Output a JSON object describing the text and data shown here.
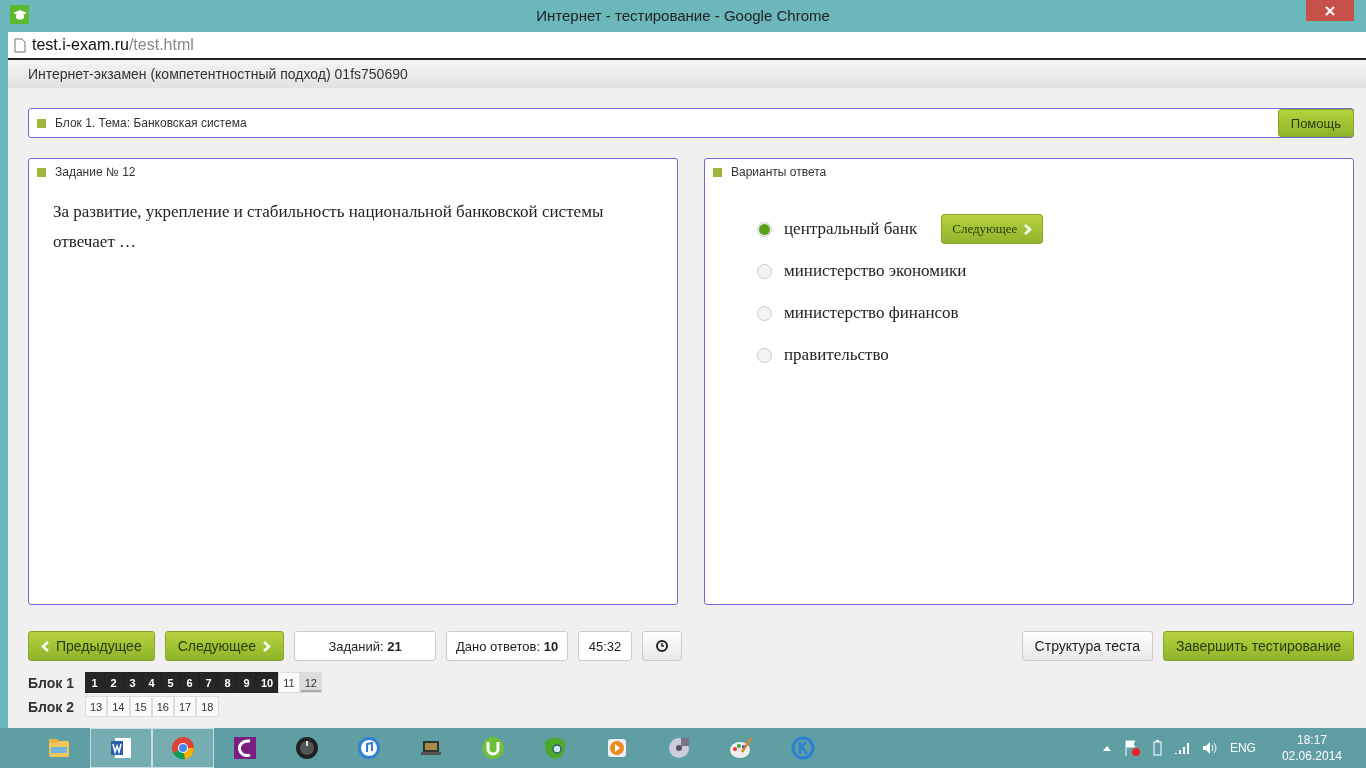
{
  "window": {
    "title": "Интернет - тестирование - Google Chrome"
  },
  "address": {
    "host": "test.i-exam.ru",
    "path": "/test.html"
  },
  "page_header": "Интернет-экзамен (компетентностный подход) 01fs750690",
  "topic": {
    "label": "Блок 1. Тема: Банковская система",
    "help_button": "Помощь"
  },
  "task": {
    "title": "Задание № 12",
    "question": "За развитие, укрепление и стабильность национальной банковской системы отвечает …"
  },
  "answers": {
    "title": "Варианты ответа",
    "next_button": "Следующее",
    "options": [
      {
        "label": "центральный банк",
        "selected": true
      },
      {
        "label": "министерство экономики",
        "selected": false
      },
      {
        "label": "министерство финансов",
        "selected": false
      },
      {
        "label": "правительство",
        "selected": false
      }
    ]
  },
  "nav": {
    "prev_button": "Предыдущее",
    "next_button": "Следующее",
    "tasks_label": "Заданий:",
    "tasks_value": "21",
    "answered_label": "Дано ответов:",
    "answered_value": "10",
    "timer": "45:32",
    "structure_button": "Структура теста",
    "finish_button": "Завершить тестирование"
  },
  "blocks": [
    {
      "label": "Блок 1",
      "groups": [
        [
          {
            "n": "1",
            "answered": true,
            "selected": false
          },
          {
            "n": "2",
            "answered": true,
            "selected": false
          },
          {
            "n": "3",
            "answered": true,
            "selected": false
          },
          {
            "n": "4",
            "answered": true,
            "selected": false
          },
          {
            "n": "5",
            "answered": true,
            "selected": false
          },
          {
            "n": "6",
            "answered": true,
            "selected": false
          },
          {
            "n": "7",
            "answered": true,
            "selected": false
          },
          {
            "n": "8",
            "answered": true,
            "selected": false
          },
          {
            "n": "9",
            "answered": true,
            "selected": false
          },
          {
            "n": "10",
            "answered": true,
            "selected": false
          },
          {
            "n": "11",
            "answered": false,
            "selected": false
          },
          {
            "n": "12",
            "answered": false,
            "selected": true
          }
        ]
      ]
    },
    {
      "label": "Блок 2",
      "groups": [
        [
          {
            "n": "13",
            "answered": false,
            "selected": false
          },
          {
            "n": "14",
            "answered": false,
            "selected": false
          },
          {
            "n": "15",
            "answered": false,
            "selected": false
          },
          {
            "n": "16",
            "answered": false,
            "selected": false
          },
          {
            "n": "17",
            "answered": false,
            "selected": false
          },
          {
            "n": "18",
            "answered": false,
            "selected": false
          }
        ]
      ]
    }
  ],
  "taskbar": {
    "apps": [
      {
        "kind": "folder",
        "active": false
      },
      {
        "kind": "word",
        "active": true
      },
      {
        "kind": "browser",
        "active": true
      },
      {
        "kind": "purple",
        "active": false
      },
      {
        "kind": "knob",
        "active": false
      },
      {
        "kind": "music",
        "active": false
      },
      {
        "kind": "laptop",
        "active": false
      },
      {
        "kind": "torrent",
        "active": false
      },
      {
        "kind": "shield",
        "active": false
      },
      {
        "kind": "player",
        "active": false
      },
      {
        "kind": "disc",
        "active": false
      },
      {
        "kind": "palette",
        "active": false
      },
      {
        "kind": "kcircle",
        "active": false
      }
    ],
    "language": "ENG",
    "time": "18:17",
    "date": "02.06.2014"
  }
}
